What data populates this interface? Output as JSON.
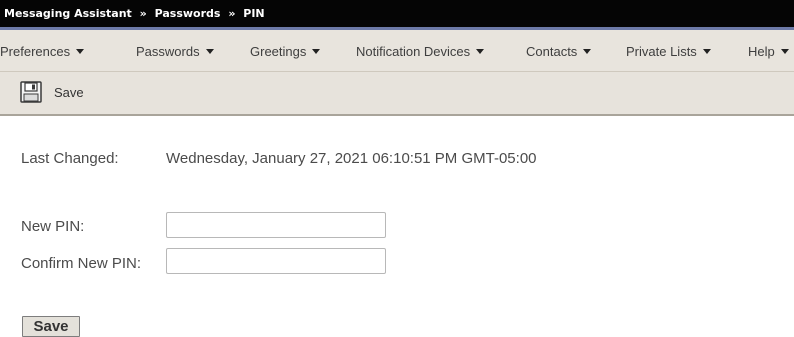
{
  "breadcrumb": {
    "items": [
      "Messaging Assistant",
      "Passwords",
      "PIN"
    ],
    "separator": "»"
  },
  "menu": {
    "items": [
      {
        "label": "Preferences",
        "icon": "chevron-down-icon"
      },
      {
        "label": "Passwords",
        "icon": "chevron-down-icon"
      },
      {
        "label": "Greetings",
        "icon": "chevron-down-icon"
      },
      {
        "label": "Notification Devices",
        "icon": "chevron-down-icon"
      },
      {
        "label": "Contacts",
        "icon": "chevron-down-icon"
      },
      {
        "label": "Private Lists",
        "icon": "chevron-down-icon"
      },
      {
        "label": "Help",
        "icon": "chevron-down-icon"
      }
    ]
  },
  "toolbar": {
    "save_label": "Save",
    "save_icon": "floppy-disk-icon"
  },
  "form": {
    "last_changed_label": "Last Changed:",
    "last_changed_value": "Wednesday, January 27, 2021 06:10:51 PM GMT-05:00",
    "new_pin_label": "New PIN:",
    "new_pin_value": "",
    "confirm_pin_label": "Confirm New PIN:",
    "confirm_pin_value": "",
    "save_button_label": "Save"
  },
  "colors": {
    "title_bar": "#050505",
    "title_bar_accent": "#6d7aa8",
    "menu_bar": "#e8e4dd",
    "text": "#4b4b4b"
  }
}
